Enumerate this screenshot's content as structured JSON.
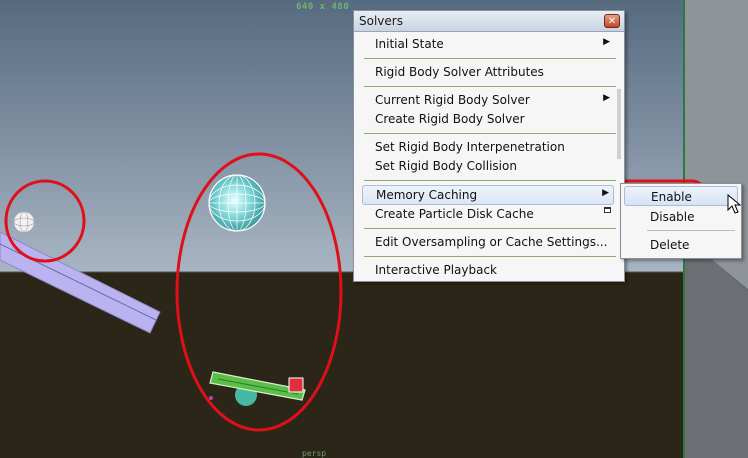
{
  "viewport": {
    "resolution_label": "640 x 480",
    "camera_label": "persp"
  },
  "solvers_menu": {
    "title": "Solvers",
    "close_glyph": "✕",
    "items": [
      {
        "label": "Initial State",
        "has_submenu": true
      },
      {
        "label": "Rigid Body Solver Attributes"
      },
      {
        "label": "Current Rigid Body Solver",
        "has_submenu": true
      },
      {
        "label": "Create Rigid Body Solver"
      },
      {
        "label": "Set Rigid Body Interpenetration"
      },
      {
        "label": "Set Rigid Body Collision"
      },
      {
        "label": "Memory Caching",
        "has_submenu": true,
        "highlighted": true
      },
      {
        "label": "Create Particle Disk Cache",
        "has_option_box": true
      },
      {
        "label": "Edit Oversampling or Cache Settings..."
      },
      {
        "label": "Interactive Playback"
      }
    ],
    "submenu_arrow_glyph": "▶"
  },
  "memory_caching_submenu": {
    "items": [
      {
        "label": "Enable",
        "highlighted": true
      },
      {
        "label": "Disable"
      },
      {
        "label": "Delete"
      }
    ]
  },
  "colors": {
    "sky_top": "#5b6f84",
    "sky_bottom": "#a7b4c2",
    "ground": "#2b2617",
    "annotation_red": "#e0101a",
    "separator_green": "#8fb06a",
    "ramp": "#b8b2ee",
    "seesaw": "#58b848"
  },
  "icons": [
    "close-icon",
    "submenu-arrow-icon",
    "option-box-icon",
    "mouse-cursor-icon"
  ]
}
